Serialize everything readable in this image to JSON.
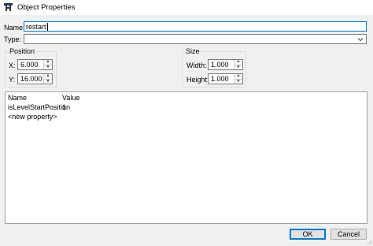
{
  "window": {
    "title": "Object Properties"
  },
  "form": {
    "name_label": "Name:",
    "name_value": "restart",
    "type_label": "Type:",
    "type_value": ""
  },
  "position": {
    "title": "Position",
    "x_label": "X:",
    "x_value": "6.000",
    "y_label": "Y:",
    "y_value": "16.000"
  },
  "size": {
    "title": "Size",
    "width_label": "Width:",
    "width_value": "1.000",
    "height_label": "Height:",
    "height_value": "1.000"
  },
  "properties": {
    "columns": [
      "Name",
      "Value"
    ],
    "rows": [
      {
        "name": "isLevelStartPosition",
        "value": "1"
      },
      {
        "name": "<new property>",
        "value": ""
      }
    ]
  },
  "buttons": {
    "ok": "OK",
    "cancel": "Cancel"
  },
  "colors": {
    "accent": "#0078d7",
    "window_bg": "#f0f0f0"
  }
}
